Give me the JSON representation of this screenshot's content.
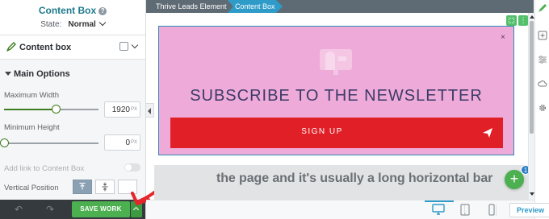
{
  "left_panel": {
    "title": "Content Box",
    "state_label": "State:",
    "state_value": "Normal",
    "element_label": "Content box",
    "section_title": "Main Options",
    "max_width": {
      "label": "Maximum Width",
      "value": "1920",
      "unit": "PX",
      "level": 0.55
    },
    "min_height": {
      "label": "Minimum Height",
      "value": "0",
      "unit": "PX",
      "level": 0.0
    },
    "link_label": "Add link to Content Box",
    "vertical_position_label": "Vertical Position",
    "vertical_position_options": [
      "top",
      "center",
      "bottom"
    ],
    "vertical_position_selected": "top"
  },
  "bottom_bar": {
    "save_label": "SAVE WORK"
  },
  "breadcrumb": {
    "items": [
      "Thrive Leads Element",
      "Content Box"
    ]
  },
  "canvas": {
    "heading": "SUBSCRIBE TO THE NEWSLETTER",
    "button_label": "SIGN UP",
    "close_glyph": "×",
    "behind_text": "the page and it's usually a long horizontal bar",
    "fab_badge": "1"
  },
  "canvas_bar": {
    "preview_label": "Preview",
    "devices": [
      "desktop",
      "tablet",
      "mobile"
    ],
    "active_device": "desktop"
  },
  "colors": {
    "accent_green": "#4cb050",
    "pink": "#eeaad8",
    "red": "#e11f26",
    "blue": "#2f9bc9",
    "heading": "#3c3b67"
  },
  "icons": [
    "help-icon",
    "pen-icon",
    "box-settings-icon",
    "mailbox-icon",
    "paper-plane-icon",
    "undo-icon",
    "redo-icon",
    "plus-icon",
    "sliders-icon",
    "cloud-icon",
    "gear-icon",
    "desktop-icon",
    "tablet-icon",
    "mobile-icon"
  ]
}
